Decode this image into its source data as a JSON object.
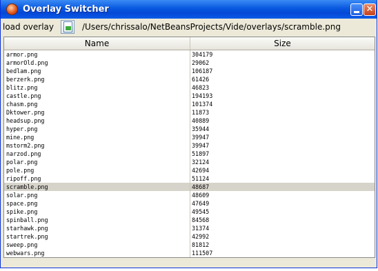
{
  "window": {
    "title": "Overlay Switcher",
    "minimize_label": "",
    "close_label": "✕"
  },
  "toolbar": {
    "load_label": "load overlay",
    "load_icon": "load-document-icon",
    "path": "/Users/chrissalo/NetBeansProjects/Vide/overlays/scramble.png"
  },
  "table": {
    "columns": [
      "Name",
      "Size"
    ],
    "selected": "scramble.png",
    "rows": [
      {
        "name": "armor.png",
        "size": "304179"
      },
      {
        "name": "armorOld.png",
        "size": "29062"
      },
      {
        "name": "bedlam.png",
        "size": "106187"
      },
      {
        "name": "berzerk.png",
        "size": "61426"
      },
      {
        "name": "blitz.png",
        "size": "46823"
      },
      {
        "name": "castle.png",
        "size": "194193"
      },
      {
        "name": "chasm.png",
        "size": "101374"
      },
      {
        "name": "Dktower.png",
        "size": "11873"
      },
      {
        "name": "headsup.png",
        "size": "40889"
      },
      {
        "name": "hyper.png",
        "size": "35944"
      },
      {
        "name": "mine.png",
        "size": "39947"
      },
      {
        "name": "mstorm2.png",
        "size": "39947"
      },
      {
        "name": "narzod.png",
        "size": "51897"
      },
      {
        "name": "polar.png",
        "size": "32124"
      },
      {
        "name": "pole.png",
        "size": "42694"
      },
      {
        "name": "ripoff.png",
        "size": "51124"
      },
      {
        "name": "scramble.png",
        "size": "48687"
      },
      {
        "name": "solar.png",
        "size": "48609"
      },
      {
        "name": "space.png",
        "size": "47649"
      },
      {
        "name": "spike.png",
        "size": "49545"
      },
      {
        "name": "spinball.png",
        "size": "84568"
      },
      {
        "name": "starhawk.png",
        "size": "31374"
      },
      {
        "name": "startrek.png",
        "size": "42992"
      },
      {
        "name": "sweep.png",
        "size": "81812"
      },
      {
        "name": "webwars.png",
        "size": "111507"
      }
    ]
  },
  "colors": {
    "titlebar": "#0a5be8",
    "selected_row": "#d6d3cb",
    "window_bg": "#ece9d8"
  }
}
